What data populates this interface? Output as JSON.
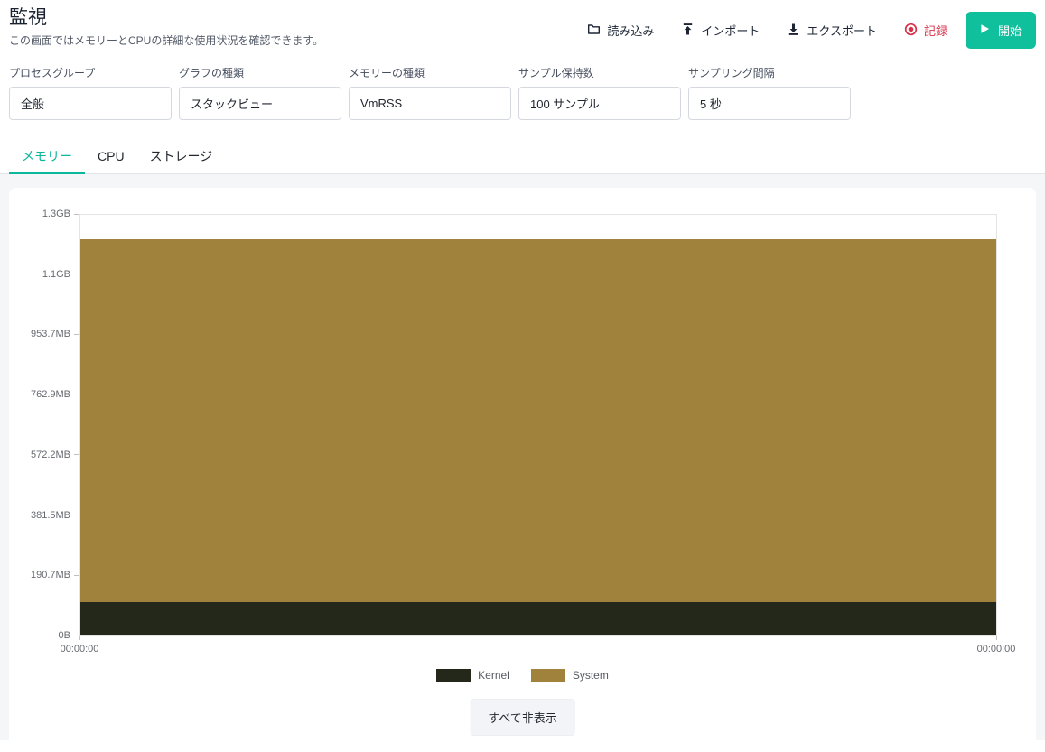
{
  "header": {
    "title": "監視",
    "subtitle": "この画面ではメモリーとCPUの詳細な使用状況を確認できます。",
    "actions": {
      "load": "読み込み",
      "import": "インポート",
      "export": "エクスポート",
      "record": "記録",
      "start": "開始"
    }
  },
  "filters": [
    {
      "label": "プロセスグループ",
      "value": "全般"
    },
    {
      "label": "グラフの種類",
      "value": "スタックビュー"
    },
    {
      "label": "メモリーの種類",
      "value": "VmRSS"
    },
    {
      "label": "サンプル保持数",
      "value": "100 サンプル"
    },
    {
      "label": "サンプリング間隔",
      "value": "5 秒"
    }
  ],
  "tabs": [
    {
      "label": "メモリー",
      "active": true
    },
    {
      "label": "CPU",
      "active": false
    },
    {
      "label": "ストレージ",
      "active": false
    }
  ],
  "chart_data": {
    "type": "area",
    "stacked": true,
    "x": [
      "00:00:00",
      "00:00:00"
    ],
    "series": [
      {
        "name": "Kernel",
        "color": "#24281b",
        "values_mb": [
          104,
          104
        ]
      },
      {
        "name": "System",
        "color": "#a0823c",
        "values_mb": [
          1155,
          1155
        ]
      }
    ],
    "y_ticks": [
      "1.3GB",
      "1.1GB",
      "953.7MB",
      "762.9MB",
      "572.2MB",
      "381.5MB",
      "190.7MB",
      "0B"
    ],
    "ylim_mb": [
      0,
      1335.1
    ],
    "x_tick_left": "00:00:00",
    "x_tick_right": "00:00:00",
    "grid": false,
    "legend_position": "bottom"
  },
  "legend": [
    {
      "label": "Kernel",
      "color": "#24281b"
    },
    {
      "label": "System",
      "color": "#a0823c"
    }
  ],
  "hide_all_label": "すべて非表示",
  "colors": {
    "accent_teal": "#10bf9c",
    "tab_active": "#0db79b",
    "record_red": "#d8324a",
    "kernel": "#24281b",
    "system": "#a0823c",
    "page_background": "#f4f6f8"
  }
}
